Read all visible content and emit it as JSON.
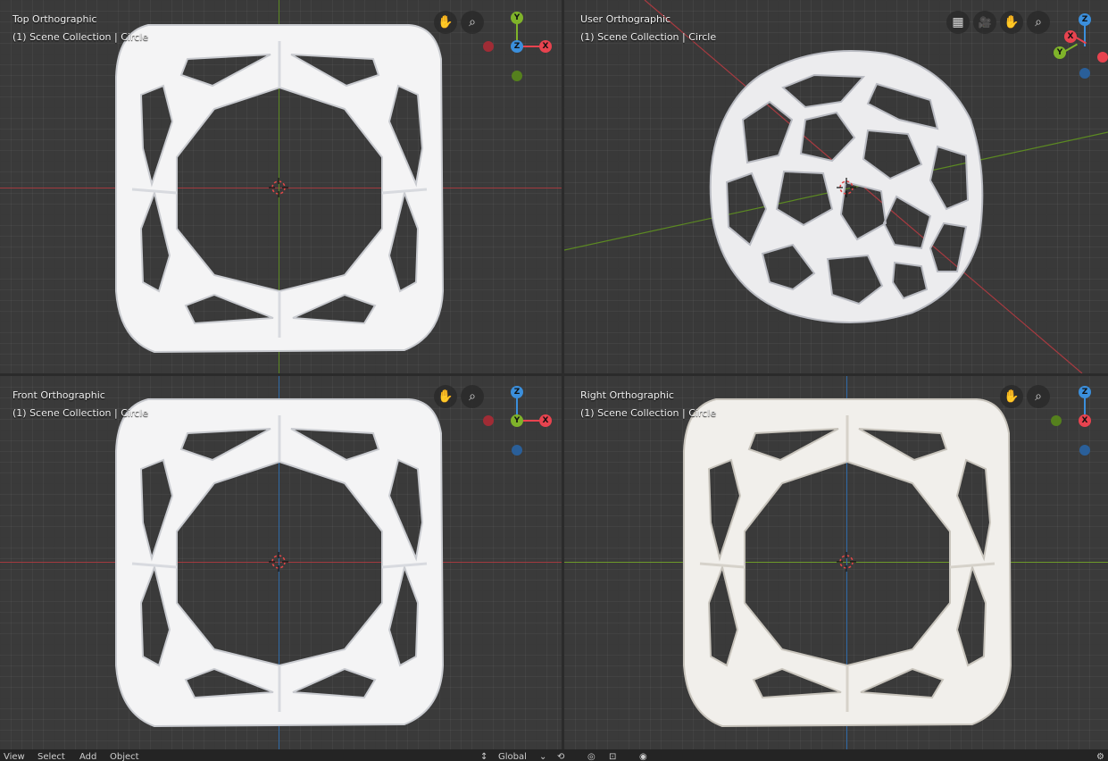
{
  "viewports": {
    "top": {
      "line1": "Top Orthographic",
      "line2": "(1) Scene Collection | Circle"
    },
    "user": {
      "line1": "User Orthographic",
      "line2": "(1) Scene Collection | Circle"
    },
    "front": {
      "line1": "Front Orthographic",
      "line2": "(1) Scene Collection | Circle"
    },
    "right": {
      "line1": "Right Orthographic",
      "line2": "(1) Scene Collection | Circle"
    }
  },
  "gizmo": {
    "top": {
      "up": "Y",
      "center": "Z",
      "right": "X"
    },
    "front": {
      "up": "Z",
      "center": "Y",
      "right": "X"
    },
    "right": {
      "up": "Z",
      "center": "X"
    },
    "user": {
      "up": "Z",
      "left": "X",
      "bottom": "Y"
    }
  },
  "icons": {
    "hand": "✋",
    "zoom": "⌕",
    "grid": "▦",
    "camera": "🎥"
  },
  "colors": {
    "x_axis": "#e8434f",
    "y_axis": "#7fb32a",
    "z_axis": "#3b8fdc",
    "model": "#f2f2f2",
    "background": "#3a3a3a"
  },
  "menubar": {
    "view": "View",
    "select": "Select",
    "add": "Add",
    "object": "Object",
    "orientation": "Global"
  }
}
